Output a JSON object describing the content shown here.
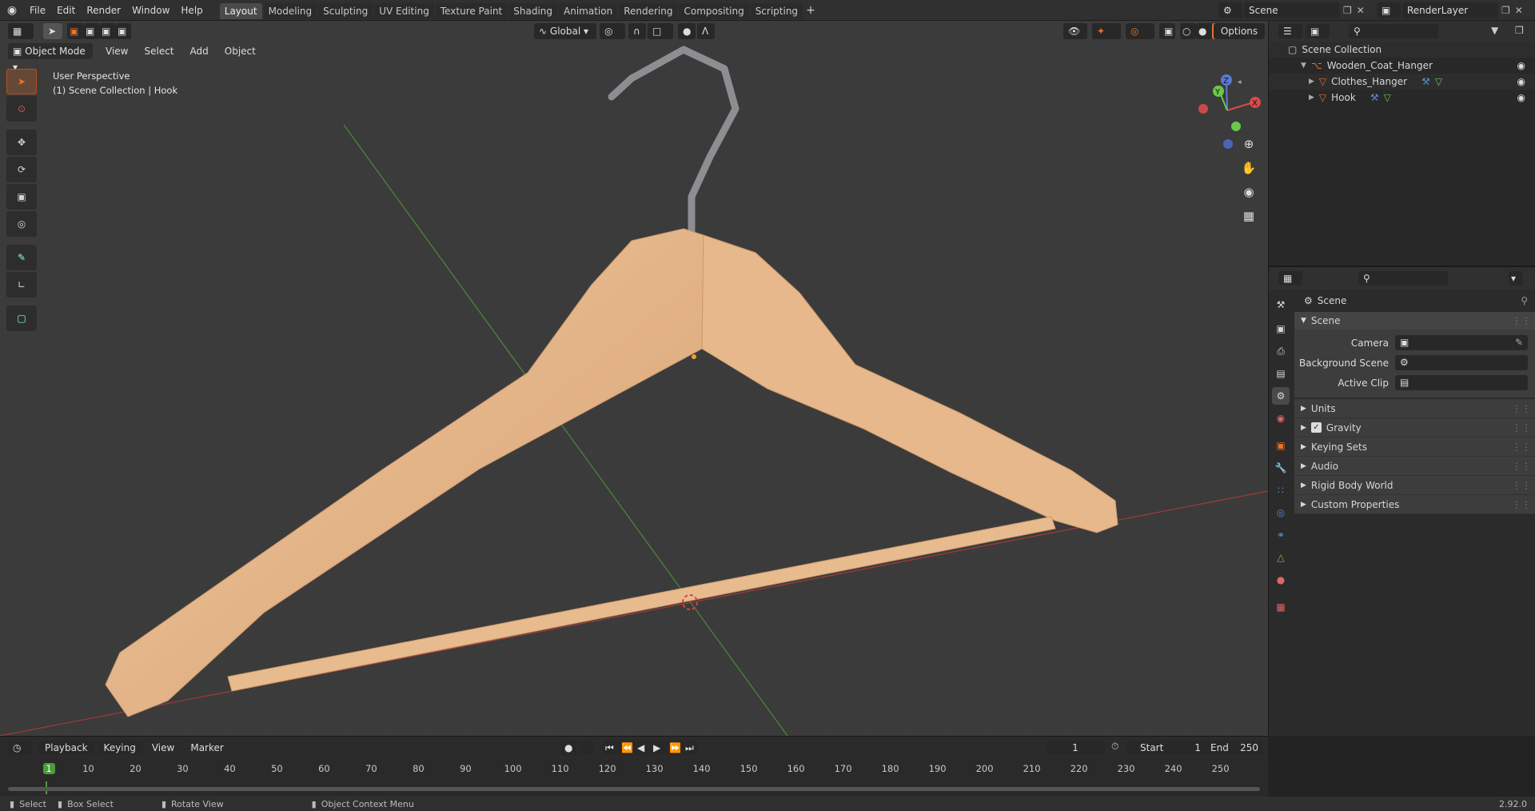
{
  "topbar": {
    "menus": [
      "File",
      "Edit",
      "Render",
      "Window",
      "Help"
    ],
    "workspaces": [
      "Layout",
      "Modeling",
      "Sculpting",
      "UV Editing",
      "Texture Paint",
      "Shading",
      "Animation",
      "Rendering",
      "Compositing",
      "Scripting"
    ],
    "active_workspace": "Layout",
    "add_tab": "+",
    "scene_name": "Scene",
    "view_layer": "RenderLayer"
  },
  "viewport": {
    "mode": "Object Mode",
    "menus": [
      "View",
      "Select",
      "Add",
      "Object"
    ],
    "transform_orientation": "Global",
    "options_label": "Options",
    "perspective_label": "User Perspective",
    "collection_label": "(1) Scene Collection | Hook",
    "gizmo": {
      "x": "X",
      "y": "Y",
      "z": "Z"
    }
  },
  "outliner": {
    "root": "Scene Collection",
    "items": [
      {
        "name": "Wooden_Coat_Hanger",
        "level": 1
      },
      {
        "name": "Clothes_Hanger",
        "level": 2
      },
      {
        "name": "Hook",
        "level": 2
      }
    ]
  },
  "properties": {
    "context": "Scene",
    "panel_title": "Scene",
    "fields": [
      {
        "label": "Camera"
      },
      {
        "label": "Background Scene"
      },
      {
        "label": "Active Clip"
      }
    ],
    "subpanels": [
      "Units",
      "Gravity",
      "Keying Sets",
      "Audio",
      "Rigid Body World",
      "Custom Properties"
    ],
    "gravity_checked": true
  },
  "timeline": {
    "menus": [
      "Playback",
      "Keying",
      "View",
      "Marker"
    ],
    "current_frame": "1",
    "start_label": "Start",
    "start": "1",
    "end_label": "End",
    "end": "250",
    "ticks": [
      "1",
      "10",
      "20",
      "30",
      "40",
      "50",
      "60",
      "70",
      "80",
      "90",
      "100",
      "110",
      "120",
      "130",
      "140",
      "150",
      "160",
      "170",
      "180",
      "190",
      "200",
      "210",
      "220",
      "230",
      "240",
      "250"
    ]
  },
  "statusbar": {
    "select": "Select",
    "box_select": "Box Select",
    "rotate_view": "Rotate View",
    "context_menu": "Object Context Menu",
    "version": "2.92.0"
  },
  "colors": {
    "accent": "#e8722c",
    "hanger_wood": "#e8b98c",
    "axis_x": "#c43c3c",
    "axis_y": "#5a9a3a"
  }
}
